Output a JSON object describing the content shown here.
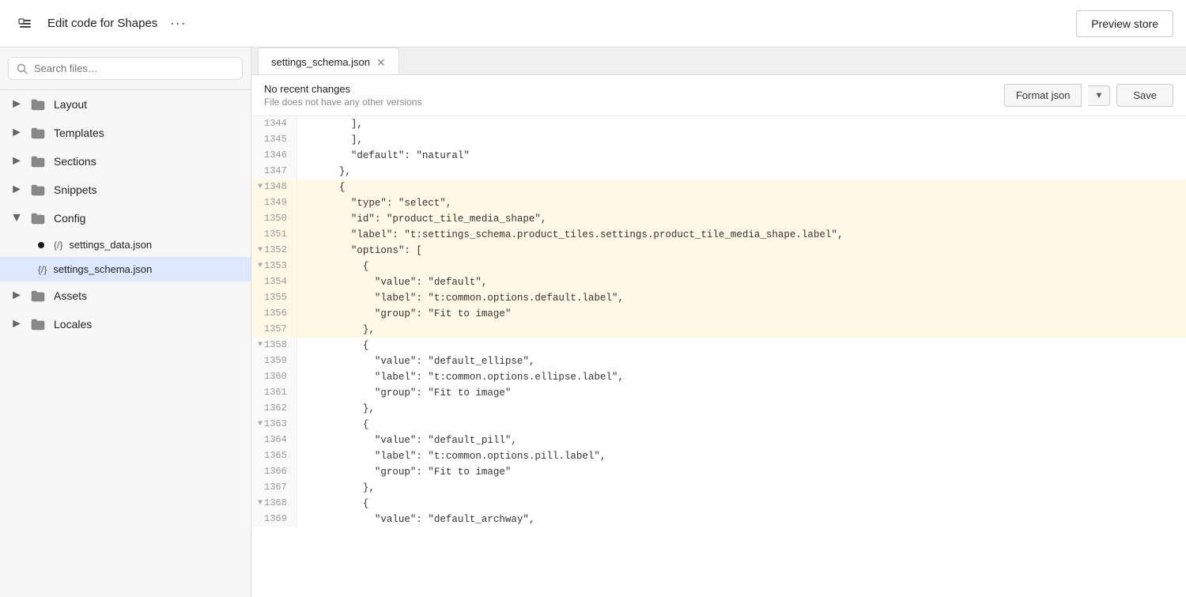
{
  "topbar": {
    "title": "Edit code for Shapes",
    "more_label": "···",
    "preview_label": "Preview store"
  },
  "sidebar": {
    "search_placeholder": "Search files…",
    "items": [
      {
        "id": "layout",
        "label": "Layout",
        "type": "folder",
        "expanded": false
      },
      {
        "id": "templates",
        "label": "Templates",
        "type": "folder",
        "expanded": false
      },
      {
        "id": "sections",
        "label": "Sections",
        "type": "folder",
        "expanded": false
      },
      {
        "id": "snippets",
        "label": "Snippets",
        "type": "folder",
        "expanded": false
      },
      {
        "id": "config",
        "label": "Config",
        "type": "folder",
        "expanded": true,
        "children": [
          {
            "id": "settings_data",
            "label": "settings_data.json",
            "active": false,
            "dot": true
          },
          {
            "id": "settings_schema",
            "label": "settings_schema.json",
            "active": true,
            "dot": false
          }
        ]
      },
      {
        "id": "assets",
        "label": "Assets",
        "type": "folder",
        "expanded": false
      },
      {
        "id": "locales",
        "label": "Locales",
        "type": "folder",
        "expanded": false
      }
    ]
  },
  "editor": {
    "tab_label": "settings_schema.json",
    "no_changes": "No recent changes",
    "no_versions": "File does not have any other versions",
    "format_btn": "Format json",
    "save_btn": "Save",
    "lines": [
      {
        "num": "1344",
        "fold": false,
        "content": "        ],"
      },
      {
        "num": "1345",
        "fold": false,
        "content": "        ],"
      },
      {
        "num": "1346",
        "fold": false,
        "content": "        \"default\": \"natural\""
      },
      {
        "num": "1347",
        "fold": false,
        "content": "      },"
      },
      {
        "num": "1348",
        "fold": true,
        "content": "      {"
      },
      {
        "num": "1349",
        "fold": false,
        "content": "        \"type\": \"select\","
      },
      {
        "num": "1350",
        "fold": false,
        "content": "        \"id\": \"product_tile_media_shape\","
      },
      {
        "num": "1351",
        "fold": false,
        "content": "        \"label\": \"t:settings_schema.product_tiles.settings.product_tile_media_shape.label\","
      },
      {
        "num": "1352",
        "fold": true,
        "content": "        \"options\": ["
      },
      {
        "num": "1353",
        "fold": true,
        "content": "          {"
      },
      {
        "num": "1354",
        "fold": false,
        "content": "            \"value\": \"default\","
      },
      {
        "num": "1355",
        "fold": false,
        "content": "            \"label\": \"t:common.options.default.label\","
      },
      {
        "num": "1356",
        "fold": false,
        "content": "            \"group\": \"Fit to image\""
      },
      {
        "num": "1357",
        "fold": false,
        "content": "          },"
      },
      {
        "num": "1358",
        "fold": true,
        "content": "          {"
      },
      {
        "num": "1359",
        "fold": false,
        "content": "            \"value\": \"default_ellipse\","
      },
      {
        "num": "1360",
        "fold": false,
        "content": "            \"label\": \"t:common.options.ellipse.label\","
      },
      {
        "num": "1361",
        "fold": false,
        "content": "            \"group\": \"Fit to image\""
      },
      {
        "num": "1362",
        "fold": false,
        "content": "          },"
      },
      {
        "num": "1363",
        "fold": true,
        "content": "          {"
      },
      {
        "num": "1364",
        "fold": false,
        "content": "            \"value\": \"default_pill\","
      },
      {
        "num": "1365",
        "fold": false,
        "content": "            \"label\": \"t:common.options.pill.label\","
      },
      {
        "num": "1366",
        "fold": false,
        "content": "            \"group\": \"Fit to image\""
      },
      {
        "num": "1367",
        "fold": false,
        "content": "          },"
      },
      {
        "num": "1368",
        "fold": true,
        "content": "          {"
      },
      {
        "num": "1369",
        "fold": false,
        "content": "            \"value\": \"default_archway\","
      }
    ],
    "highlight_range": [
      1348,
      1357
    ],
    "colors": {
      "string": "#c0392b",
      "key": "#333",
      "highlight_bg": "#f0f4ff"
    }
  }
}
